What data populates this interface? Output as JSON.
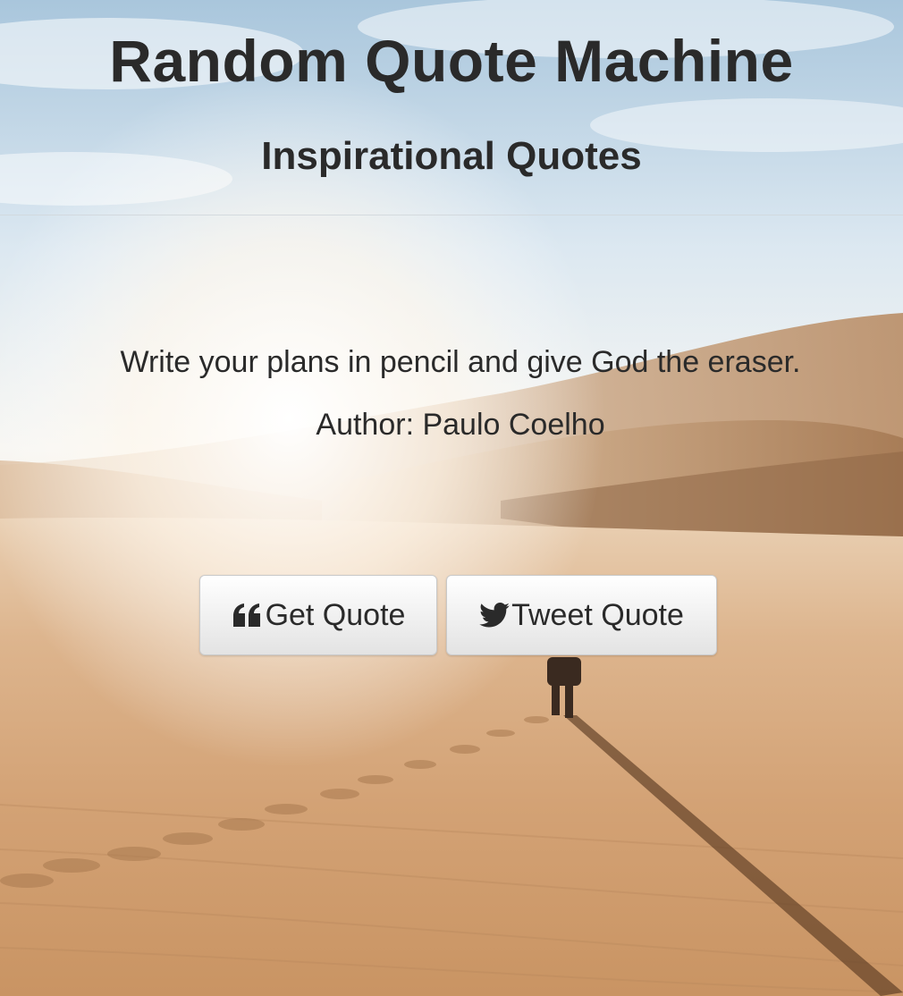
{
  "header": {
    "title": "Random Quote Machine",
    "subtitle": "Inspirational Quotes"
  },
  "quote": {
    "text": "Write your plans in pencil and give God the eraser.",
    "author_line": "Author: Paulo Coelho"
  },
  "buttons": {
    "get_quote": {
      "label": "Get Quote",
      "icon": "quote-left-icon"
    },
    "tweet_quote": {
      "label": "Tweet Quote",
      "icon": "twitter-bird-icon"
    }
  },
  "colors": {
    "text": "#2a2a2a",
    "sky": "#b9d3e6",
    "sand": "#d8a877",
    "button_top": "#ffffff",
    "button_bottom": "#e3e3e3"
  },
  "background": {
    "scene": "desert-dunes-with-walker"
  }
}
